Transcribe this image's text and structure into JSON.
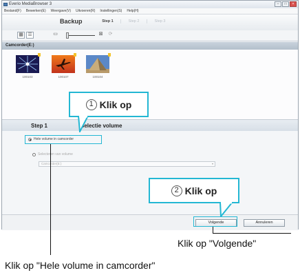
{
  "window": {
    "title": "Everio MediaBrowser 3",
    "menu": [
      "Bestand(F)",
      "Bewerken(E)",
      "Weergave(V)",
      "Uitvoeren(R)",
      "Instellingen(S)",
      "Help(H)"
    ]
  },
  "header": {
    "app_title": "Backup",
    "steps": [
      "Step 1",
      "Step 2",
      "Step 3"
    ],
    "active_step_index": 0
  },
  "toolbar": {
    "icons": [
      "grid-view-icon",
      "list-view-icon",
      "zoom-out-icon",
      "zoom-slider",
      "zoom-in-icon",
      "refresh-icon"
    ]
  },
  "source": {
    "label": "Camcorder(E:)"
  },
  "thumbnails": [
    {
      "label": "100103",
      "subject": "fireworks"
    },
    {
      "label": "100107",
      "subject": "airplane"
    },
    {
      "label": "100104",
      "subject": "pyramid"
    }
  ],
  "step_row": {
    "step": "Step 1",
    "title": "Selectie volume"
  },
  "options": {
    "whole_volume": "Hele volume in camcorder",
    "select_from_volume": "Selecteren van volume",
    "dropdown_value": "Camcorder(E:)"
  },
  "footer": {
    "next_button": "Volgende",
    "cancel_button": "Annuleren"
  },
  "callouts": {
    "first": {
      "number": "1",
      "text": "Klik op"
    },
    "second": {
      "number": "2",
      "text": "Klik op"
    }
  },
  "captions": {
    "next": "Klik op \"Volgende\"",
    "whole_volume": "Klik op \"Hele volume in camcorder\""
  },
  "colors": {
    "accent": "#23b7d3",
    "close_button": "#d9534f"
  }
}
